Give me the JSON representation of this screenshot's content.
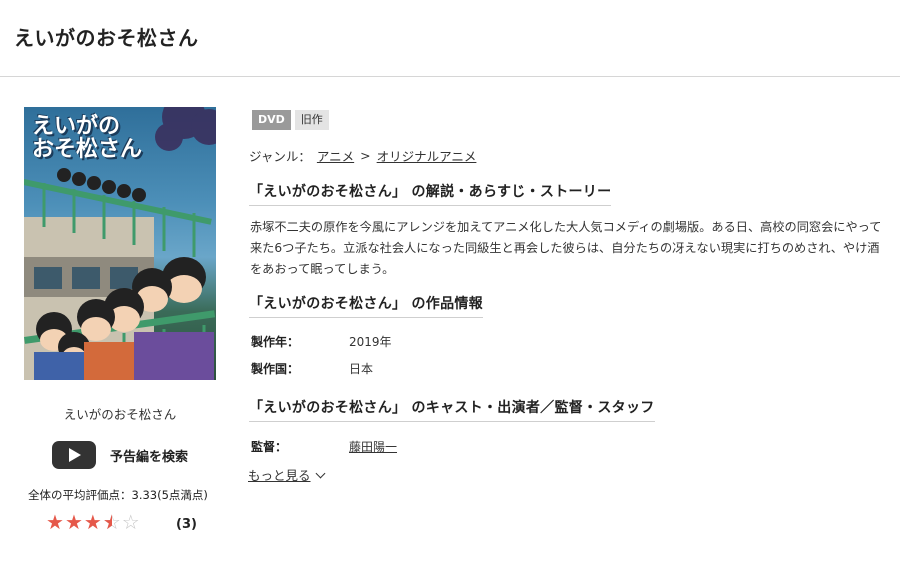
{
  "header": {
    "title": "えいがのおそ松さん"
  },
  "poster": {
    "title_line1": "えいがの",
    "title_line2": "おそ松さん"
  },
  "left": {
    "caption": "えいがのおそ松さん",
    "trailer_label": "予告編を検索",
    "average_rating_text": "全体の平均評価点：3.33(5点満点)",
    "rating": {
      "value": 3.33,
      "max": 5,
      "display_stars": 3.5
    },
    "review_count": "(3)"
  },
  "tags": {
    "format": "DVD",
    "status": "旧作"
  },
  "genre": {
    "label": "ジャンル：",
    "primary": "アニメ",
    "separator": ">",
    "secondary": "オリジナルアニメ"
  },
  "synopsis": {
    "heading": "「えいがのおそ松さん」 の解説・あらすじ・ストーリー",
    "text": "赤塚不二夫の原作を今風にアレンジを加えてアニメ化した大人気コメディの劇場版。ある日、高校の同窓会にやって来た6つ子たち。立派な社会人になった同級生と再会した彼らは、自分たちの冴えない現実に打ちのめされ、やけ酒をあおって眠ってしまう。"
  },
  "info": {
    "heading": "「えいがのおそ松さん」 の作品情報",
    "year_label": "製作年：",
    "year_value": "2019年",
    "country_label": "製作国：",
    "country_value": "日本"
  },
  "cast": {
    "heading": "「えいがのおそ松さん」 のキャスト・出演者／監督・スタッフ",
    "director_label": "監督：",
    "director_value": "藤田陽一",
    "more_label": "もっと見る"
  },
  "colors": {
    "star": "#e5584a",
    "tag_dvd": "#9a9a9a",
    "tag_old": "#e4e4e4"
  }
}
